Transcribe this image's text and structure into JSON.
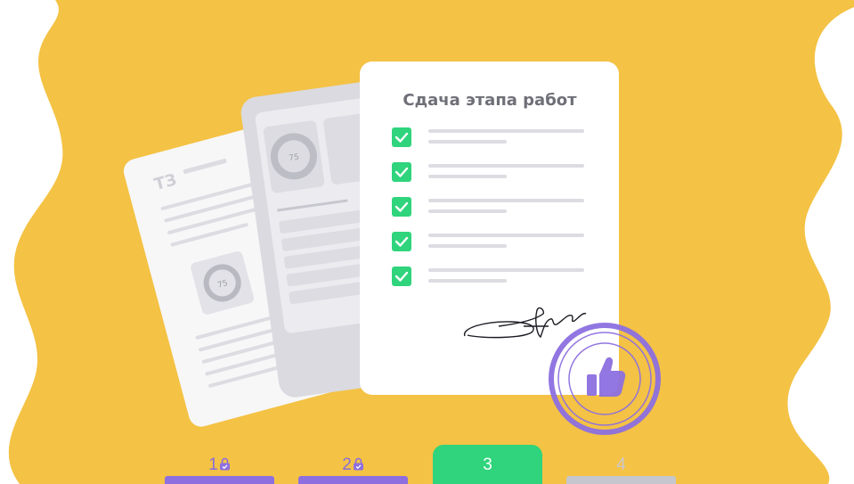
{
  "document": {
    "title": "Сдача этапа работ",
    "checklist_count": 5
  },
  "back_docs": {
    "tz_label": "ТЗ",
    "gauge_value_front": "75",
    "gauge_value_back": "75"
  },
  "stamp": {
    "icon": "thumbs-up-icon"
  },
  "steps": [
    {
      "label": "1",
      "state": "completed",
      "icon": "lock-icon"
    },
    {
      "label": "2",
      "state": "completed",
      "icon": "lock-icon"
    },
    {
      "label": "3",
      "state": "active"
    },
    {
      "label": "4",
      "state": "upcoming"
    }
  ],
  "colors": {
    "background": "#f4c244",
    "check": "#2fd47c",
    "stamp": "#8d6fe0",
    "step_active": "#2fd47c",
    "step_done": "#8d6fe0",
    "step_upcoming": "#c6c6ce"
  }
}
